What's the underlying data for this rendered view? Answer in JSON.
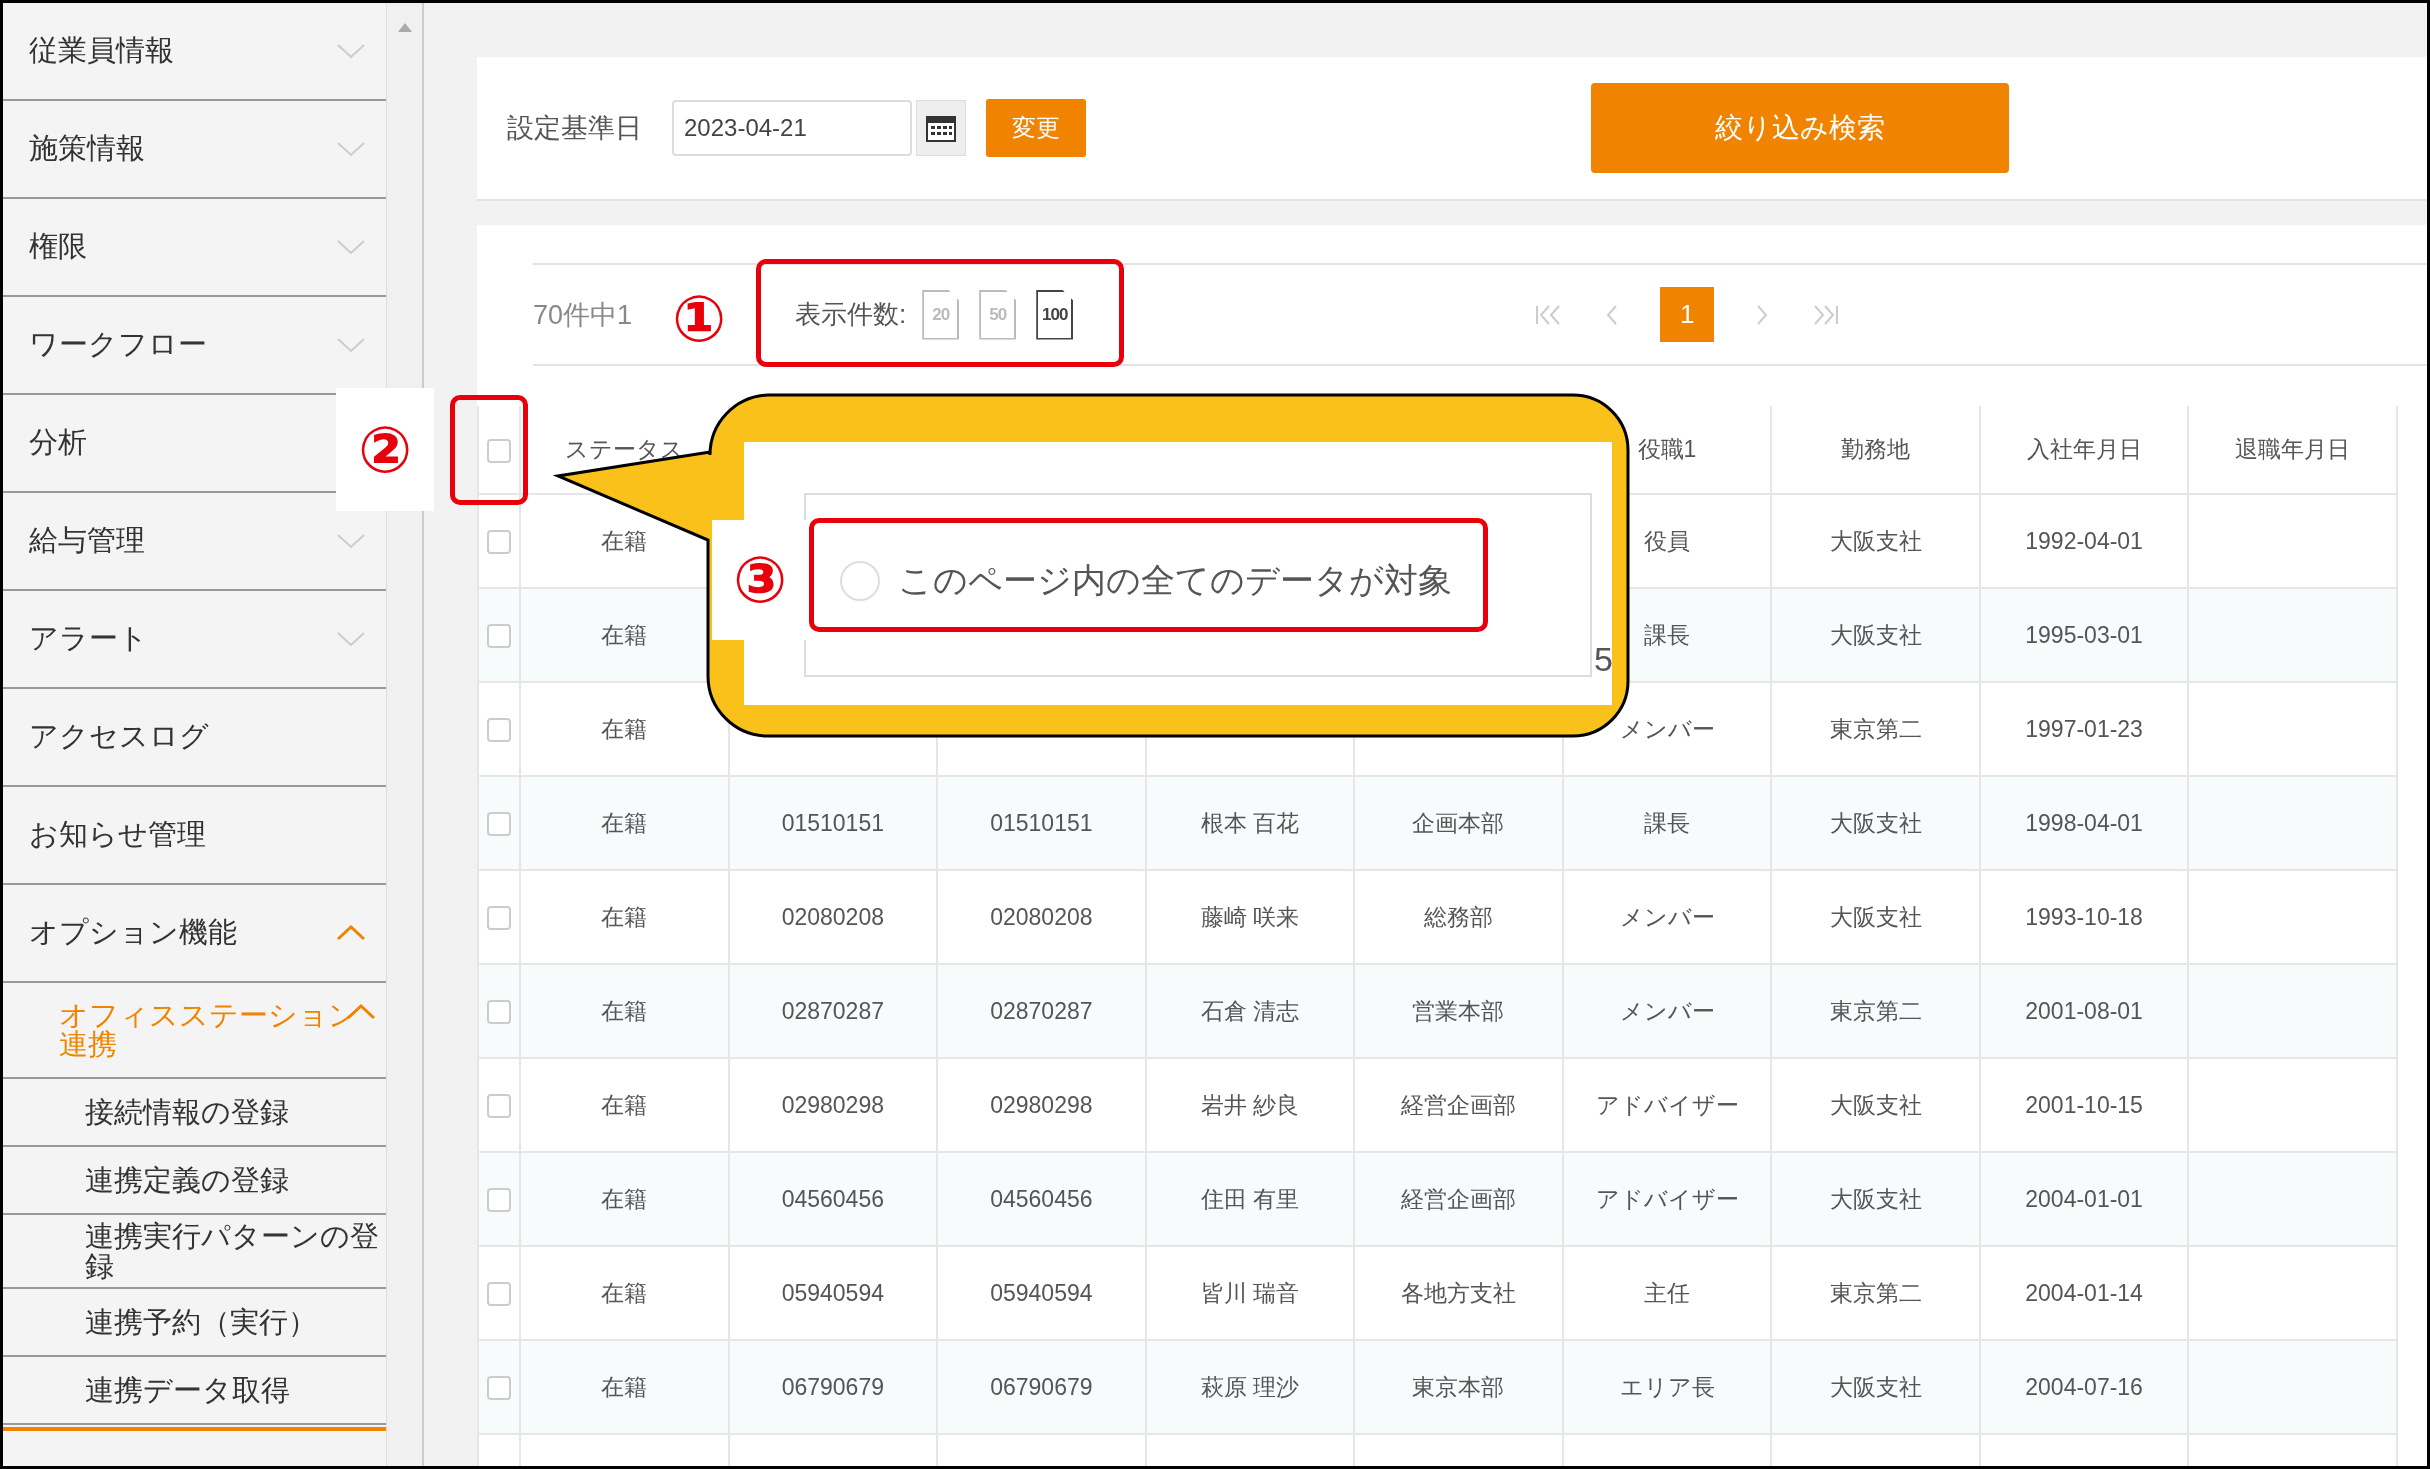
{
  "sidebar": {
    "items": [
      {
        "label": "従業員情報",
        "expanded": false
      },
      {
        "label": "施策情報",
        "expanded": false
      },
      {
        "label": "権限",
        "expanded": false
      },
      {
        "label": "ワークフロー",
        "expanded": false
      },
      {
        "label": "分析"
      },
      {
        "label": "給与管理",
        "expanded": false
      },
      {
        "label": "アラート",
        "expanded": false
      },
      {
        "label": "アクセスログ"
      },
      {
        "label": "お知らせ管理"
      },
      {
        "label": "オプション機能",
        "expanded": true,
        "children": [
          {
            "label": "オフィスステーション連携",
            "expanded": true,
            "children": [
              {
                "label": "接続情報の登録"
              },
              {
                "label": "連携定義の登録"
              },
              {
                "label": "連携実行パターンの登録"
              },
              {
                "label": "連携予約（実行）"
              },
              {
                "label": "連携データ取得"
              }
            ]
          }
        ]
      }
    ]
  },
  "filter": {
    "date_label": "設定基準日",
    "date_value": "2023-04-21",
    "change_button": "変更",
    "search_button": "絞り込み検索"
  },
  "pagination": {
    "count_text": "70件中1",
    "page_size_label": "表示件数:",
    "page_sizes": [
      {
        "label": "20",
        "selected": false
      },
      {
        "label": "50",
        "selected": false
      },
      {
        "label": "100",
        "selected": true
      }
    ],
    "pages": [
      {
        "label": "1",
        "selected": true
      }
    ]
  },
  "table": {
    "header_checked": false,
    "columns": [
      "ステータス",
      null,
      null,
      null,
      null,
      "役職1",
      "勤務地",
      "入社年月日",
      "退職年月日"
    ],
    "rows": [
      {
        "checked": false,
        "cells": [
          "在籍",
          null,
          null,
          null,
          null,
          "役員",
          "大阪支社",
          "1992-04-01",
          null
        ]
      },
      {
        "checked": false,
        "cells": [
          "在籍",
          null,
          null,
          null,
          null,
          "課長",
          "大阪支社",
          "1995-03-01",
          null
        ]
      },
      {
        "checked": false,
        "cells": [
          "在籍",
          null,
          null,
          null,
          null,
          "メンバー",
          "東京第二",
          "1997-01-23",
          null
        ]
      },
      {
        "checked": false,
        "cells": [
          "在籍",
          "01510151",
          "01510151",
          "根本 百花",
          "企画本部",
          "課長",
          "大阪支社",
          "1998-04-01",
          null
        ]
      },
      {
        "checked": false,
        "cells": [
          "在籍",
          "02080208",
          "02080208",
          "藤崎 咲来",
          "総務部",
          "メンバー",
          "大阪支社",
          "1993-10-18",
          null
        ]
      },
      {
        "checked": false,
        "cells": [
          "在籍",
          "02870287",
          "02870287",
          "石倉 清志",
          "営業本部",
          "メンバー",
          "東京第二",
          "2001-08-01",
          null
        ]
      },
      {
        "checked": false,
        "cells": [
          "在籍",
          "02980298",
          "02980298",
          "岩井 紗良",
          "経営企画部",
          "アドバイザー",
          "大阪支社",
          "2001-10-15",
          null
        ]
      },
      {
        "checked": false,
        "cells": [
          "在籍",
          "04560456",
          "04560456",
          "住田 有里",
          "経営企画部",
          "アドバイザー",
          "大阪支社",
          "2004-01-01",
          null
        ]
      },
      {
        "checked": false,
        "cells": [
          "在籍",
          "05940594",
          "05940594",
          "皆川 瑞音",
          "各地方支社",
          "主任",
          "東京第二",
          "2004-01-14",
          null
        ]
      },
      {
        "checked": false,
        "cells": [
          "在籍",
          "06790679",
          "06790679",
          "萩原 理沙",
          "東京本部",
          "エリア長",
          "大阪支社",
          "2004-07-16",
          null
        ]
      }
    ]
  },
  "callout": {
    "option": {
      "label": "このページ内の全てのデータが対象",
      "selected": false
    },
    "partial_text": "5"
  },
  "annotations": [
    "①",
    "②",
    "③"
  ]
}
